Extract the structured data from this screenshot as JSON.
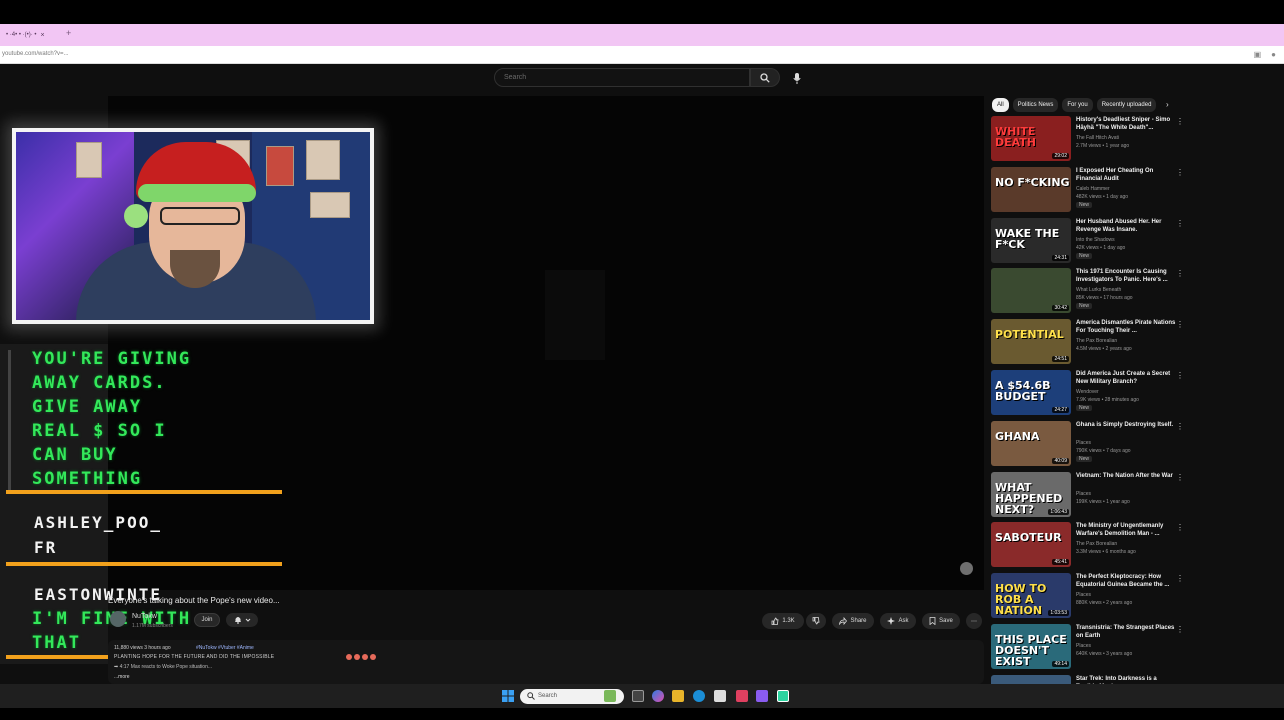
{
  "browser": {
    "tab_label": "• ·4• • ·(•)· •",
    "tab_close": "×",
    "new_tab": "+",
    "url": "youtube.com/watch?v=..."
  },
  "youtube": {
    "search_placeholder": "Search",
    "chips": [
      "All",
      "Politics News",
      "For you",
      "Recently uploaded"
    ],
    "chip_next": "›"
  },
  "chat": {
    "message1_lines": [
      "YOU'RE GIVING",
      "AWAY CARDS.",
      "GIVE AWAY",
      "REAL $ SO I",
      "CAN BUY",
      "SOMETHING"
    ],
    "user2": "ASHLEY_POO_",
    "message2": "FR",
    "user3": "EASTONWINTE",
    "message3_lines": [
      "I'M FINE WITH",
      "THAT"
    ]
  },
  "video": {
    "title": "Everyone's talking about the Pope's new video...",
    "channel": "NuTokw",
    "subs": "1.17M subscribers",
    "join": "Join",
    "likes": "1.3K",
    "share": "Share",
    "ask": "Ask",
    "save": "Save",
    "more": "⋯",
    "views_time": "11,880 views  3 hours ago",
    "hashtags": "#NuTokw #Vtuber #Anime",
    "desc_caps": "PLANTING HOPE FOR THE FUTURE AND DID THE IMPOSSIBLE",
    "desc_line": "➡ 4:17 Max reacts to Woke Pope situation...",
    "desc_more": "...more"
  },
  "recommendations": [
    {
      "thumb_text": "WHITE DEATH",
      "duration": "29:02",
      "title": "History's Deadliest Sniper - Simo Häyhä \"The White Death\"...",
      "channel": "The Fall Hitch Avati",
      "meta": "2.7M views • 1 year ago",
      "badge": ""
    },
    {
      "thumb_text": "NO F*CKING",
      "duration": "",
      "title": "I Exposed Her Cheating On Financial Audit",
      "channel": "Caleb Hammer",
      "meta": "482K views • 1 day ago",
      "badge": "New"
    },
    {
      "thumb_text": "WAKE THE F*CK",
      "duration": "24:31",
      "title": "Her Husband Abused Her. Her Revenge Was Insane.",
      "channel": "Into the Shadows",
      "meta": "42K views • 1 day ago",
      "badge": "New"
    },
    {
      "thumb_text": "",
      "duration": "30:42",
      "title": "This 1971 Encounter Is Causing Investigators To Panic. Here's ...",
      "channel": "What Lurks Beneath",
      "meta": "85K views • 17 hours ago",
      "badge": "New"
    },
    {
      "thumb_text": "POTENTIAL",
      "duration": "24:51",
      "title": "America Dismantles Pirate Nations For Touching Their ...",
      "channel": "The Pax Borealian",
      "meta": "4.5M views • 2 years ago",
      "badge": ""
    },
    {
      "thumb_text": "A $54.6B BUDGET",
      "duration": "24:27",
      "title": "Did America Just Create a Secret New Military Branch?",
      "channel": "Wendover",
      "meta": "7.9K views • 28 minutes ago",
      "badge": "New"
    },
    {
      "thumb_text": "GHANA",
      "duration": "40:09",
      "title": "Ghana is Simply Destroying Itself.",
      "channel": "Places",
      "meta": "790K views • 7 days ago",
      "badge": "New"
    },
    {
      "thumb_text": "WHAT HAPPENED NEXT?",
      "duration": "1:06:43",
      "title": "Vietnam: The Nation After the War",
      "channel": "Places",
      "meta": "199K views • 1 year ago",
      "badge": ""
    },
    {
      "thumb_text": "SABOTEUR",
      "duration": "45:41",
      "title": "The Ministry of Ungentlemanly Warfare's Demolition Man - ...",
      "channel": "The Pax Borealian",
      "meta": "3.3M views • 6 months ago",
      "badge": ""
    },
    {
      "thumb_text": "HOW TO ROB A NATION",
      "duration": "1:03:53",
      "title": "The Perfect Kleptocracy: How Equatorial Guinea Became the ...",
      "channel": "Places",
      "meta": "880K views • 2 years ago",
      "badge": ""
    },
    {
      "thumb_text": "THIS PLACE DOESN'T EXIST",
      "duration": "49:14",
      "title": "Transnistria: The Strangest Places on Earth",
      "channel": "Places",
      "meta": "640K views • 3 years ago",
      "badge": ""
    },
    {
      "thumb_text": "",
      "duration": "",
      "title": "Star Trek: Into Darkness is a Terrible Movie",
      "channel": "",
      "meta": "",
      "badge": ""
    }
  ],
  "taskbar": {
    "search_label": "Search"
  }
}
